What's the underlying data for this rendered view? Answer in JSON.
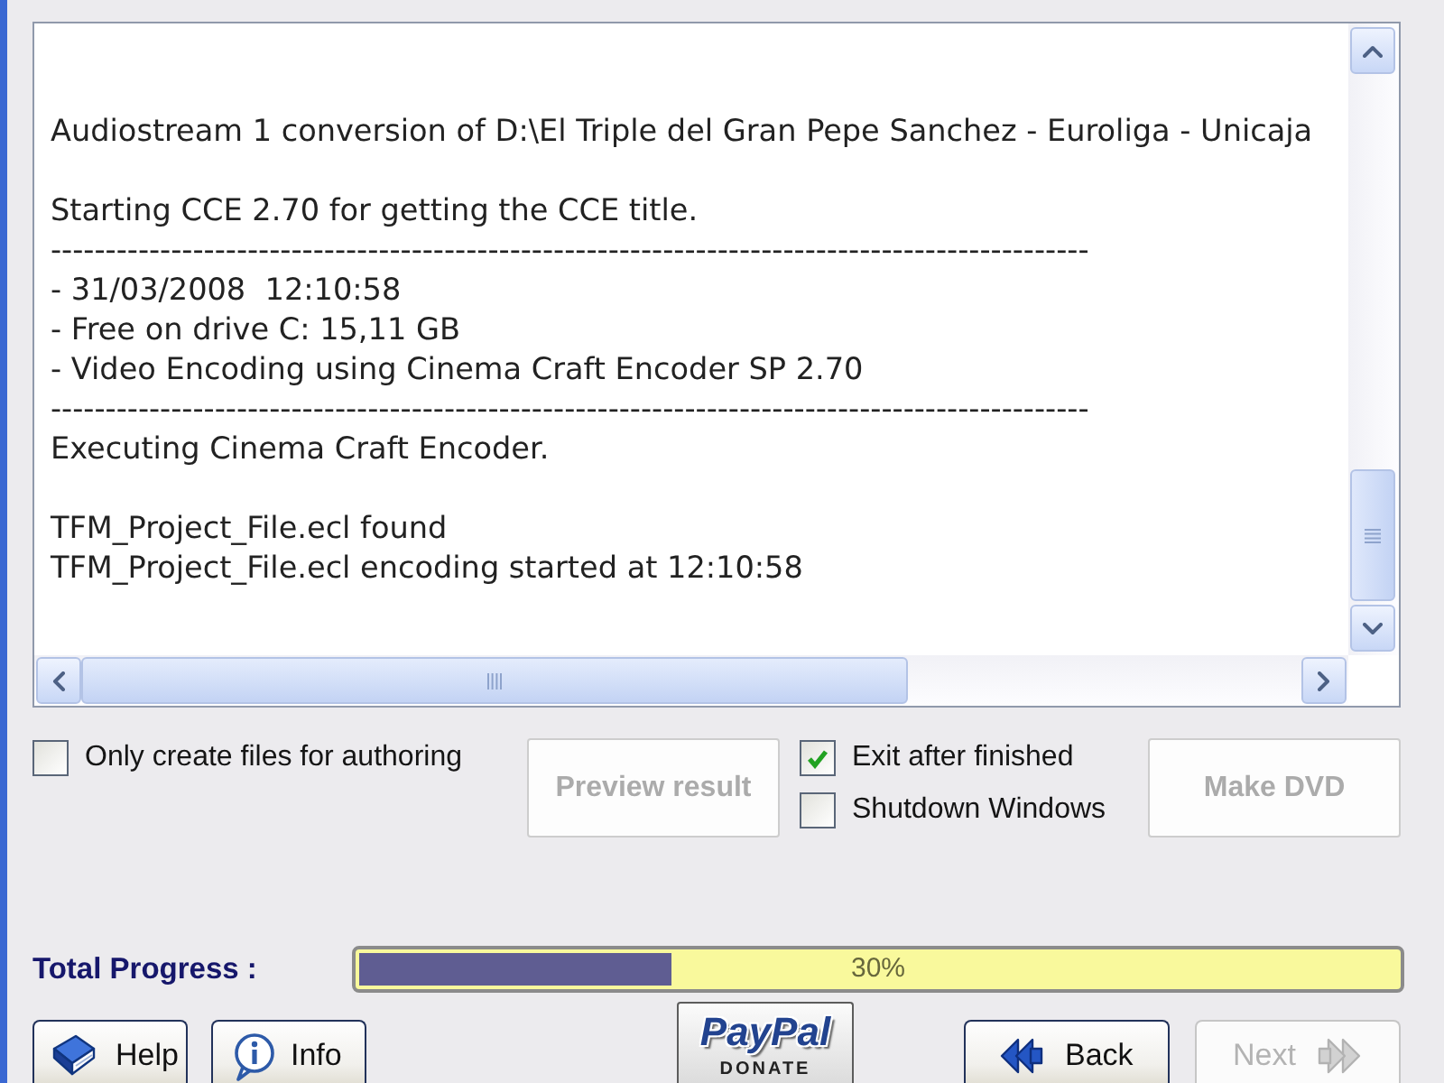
{
  "log": {
    "blocks": [
      [
        "Audiostream 1 conversion of D:\\El Triple del Gran Pepe Sanchez - Euroliga - Unicaja"
      ],
      [
        "Starting CCE 2.70 for getting the CCE title.",
        "-----------------------------------------------------------------------------------------------",
        "- 31/03/2008  12:10:58",
        "- Free on drive C: 15,11 GB",
        "- Video Encoding using Cinema Craft Encoder SP 2.70",
        "-----------------------------------------------------------------------------------------------",
        "Executing Cinema Craft Encoder."
      ],
      [
        "TFM_Project_File.ecl found",
        "TFM_Project_File.ecl encoding started at 12:10:58"
      ]
    ]
  },
  "authoring_option": {
    "label": "Only create files for authoring",
    "checked": false
  },
  "preview_button": {
    "label": "Preview result",
    "disabled": true
  },
  "finish_options": [
    {
      "label": "Exit after finished",
      "checked": true
    },
    {
      "label": "Shutdown Windows",
      "checked": false
    }
  ],
  "make_dvd_button": {
    "label": "Make DVD",
    "disabled": true
  },
  "progress": {
    "label": "Total Progress :",
    "level": 0.3,
    "reading": "30%"
  },
  "help_button": {
    "label": "Help"
  },
  "info_button": {
    "label": "Info"
  },
  "donate_button": {
    "brand": "PayPal",
    "caption": "DONATE"
  },
  "back_button": {
    "label": "Back",
    "disabled": false
  },
  "next_button": {
    "label": "Next",
    "disabled": true
  }
}
